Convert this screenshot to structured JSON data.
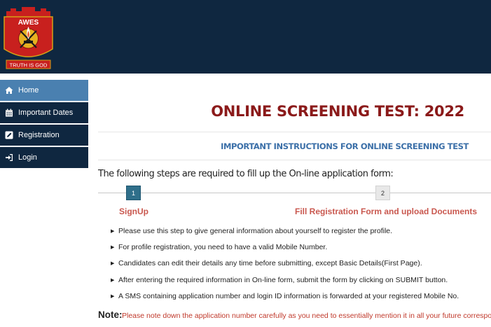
{
  "logo": {
    "top_text": "AWES",
    "motto": "TRUTH IS GOD"
  },
  "sidebar": {
    "items": [
      {
        "label": "Home",
        "icon": "home-icon",
        "active": true
      },
      {
        "label": "Important Dates",
        "icon": "calendar-icon",
        "active": false
      },
      {
        "label": "Registration",
        "icon": "edit-icon",
        "active": false
      },
      {
        "label": "Login",
        "icon": "sign-in-icon",
        "active": false
      }
    ]
  },
  "main": {
    "title": "ONLINE SCREENING TEST: 2022",
    "subtitle": "IMPORTANT INSTRUCTIONS FOR ONLINE SCREENING TEST",
    "steps_intro": "The following steps are required to fill up the On-line application form:",
    "steps": [
      {
        "number": "1",
        "label": "SignUp"
      },
      {
        "number": "2",
        "label": "Fill Registration Form and upload Documents"
      }
    ],
    "instructions": [
      "Please use this step to give general information about yourself to register the profile.",
      "For profile registration, you need to have a valid Mobile Number.",
      "Candidates can edit their details any time before submitting, except Basic Details(First Page).",
      "After entering the required information in On-line form, submit the form by clicking on SUBMIT button.",
      "A SMS containing application number and login ID information is forwarded at your registered Mobile No."
    ],
    "note_label": "Note:",
    "note_text": "Please note down the application number carefully as you need to essentially mention it in all your future correspondence"
  },
  "colors": {
    "header_bg": "#0f2740",
    "nav_active": "#4a80b0",
    "title": "#8b1a1a",
    "subtitle": "#3b6fa8",
    "step_label": "#c9584f",
    "note_text": "#c0392b"
  }
}
